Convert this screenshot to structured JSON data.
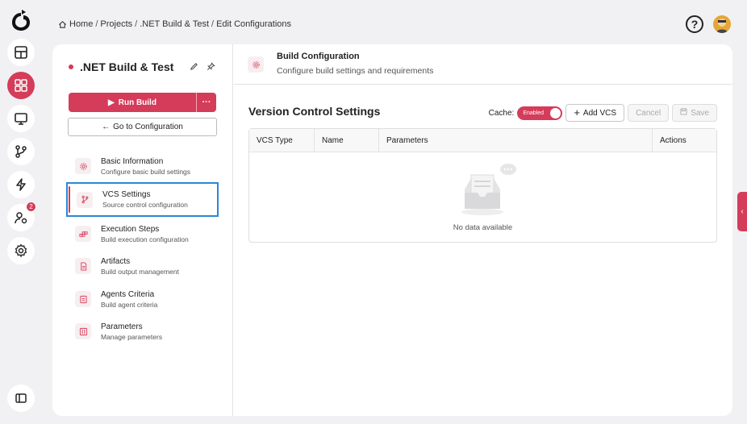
{
  "breadcrumb": {
    "items": [
      "Home",
      "Projects",
      ".NET Build & Test",
      "Edit Configurations"
    ],
    "separator": "/"
  },
  "rail": {
    "badge_count": "2",
    "accent": "#d43c5a"
  },
  "project": {
    "title": ".NET Build & Test",
    "run_label": "Run Build",
    "more_label": "···",
    "goto_label": "Go to Configuration",
    "goto_arrow": "←"
  },
  "nav": [
    {
      "title": "Basic Information",
      "subtitle": "Configure basic build settings"
    },
    {
      "title": "VCS Settings",
      "subtitle": "Source control configuration"
    },
    {
      "title": "Execution Steps",
      "subtitle": "Build execution configuration"
    },
    {
      "title": "Artifacts",
      "subtitle": "Build output management"
    },
    {
      "title": "Agents Criteria",
      "subtitle": "Build agent criteria"
    },
    {
      "title": "Parameters",
      "subtitle": "Manage parameters"
    }
  ],
  "header": {
    "title": "Build Configuration",
    "subtitle": "Configure build settings and requirements"
  },
  "section": {
    "title": "Version Control Settings",
    "cache_label": "Cache:",
    "cache_state": "Enabled",
    "add_label": "Add VCS",
    "cancel_label": "Cancel",
    "save_label": "Save"
  },
  "table": {
    "columns": [
      "VCS Type",
      "Name",
      "Parameters",
      "Actions"
    ],
    "empty_text": "No data available"
  },
  "help_label": "?",
  "side_tab_label": "‹"
}
